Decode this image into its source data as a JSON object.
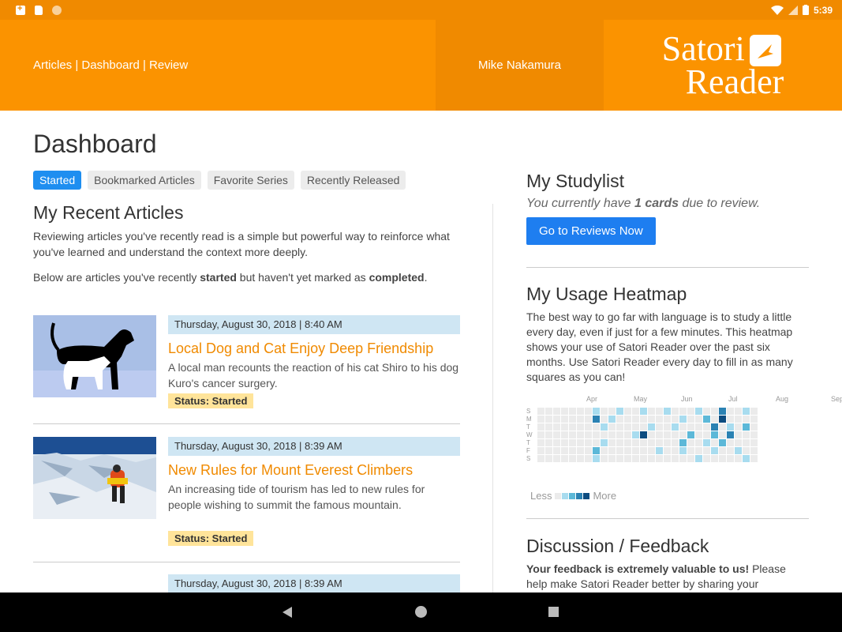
{
  "status_bar": {
    "time": "5:39"
  },
  "header": {
    "nav_links": "Articles | Dashboard | Review",
    "user_name": "Mike Nakamura",
    "logo_line1": "Satori",
    "logo_line2": "Reader"
  },
  "page_title": "Dashboard",
  "tabs": [
    {
      "label": "Started"
    },
    {
      "label": "Bookmarked Articles"
    },
    {
      "label": "Favorite Series"
    },
    {
      "label": "Recently Released"
    }
  ],
  "recent": {
    "title": "My Recent Articles",
    "intro": "Reviewing articles you've recently read is a simple but powerful way to reinforce what you've learned and understand the context more deeply.",
    "note_pre": "Below are articles you've recently ",
    "note_bold1": "started",
    "note_mid": " but haven't yet marked as ",
    "note_bold2": "completed",
    "note_end": "."
  },
  "articles": [
    {
      "date": "Thursday, August 30, 2018 | 8:40 AM",
      "title": "Local Dog and Cat Enjoy Deep Friendship",
      "summary": "A local man recounts the reaction of his cat Shiro to his dog Kuro's cancer surgery.",
      "status": "Status: Started"
    },
    {
      "date": "Thursday, August 30, 2018 | 8:39 AM",
      "title": "New Rules for Mount Everest Climbers",
      "summary": "An increasing tide of tourism has led to new rules for people wishing to summit the famous mountain.",
      "status": "Status: Started"
    },
    {
      "date": "Thursday, August 30, 2018 | 8:39 AM"
    }
  ],
  "studylist": {
    "title": "My Studylist",
    "sub_pre": "You currently have ",
    "sub_count": "1 cards",
    "sub_post": " due to review.",
    "button": "Go to Reviews Now"
  },
  "heatmap": {
    "title": "My Usage Heatmap",
    "description": "The best way to go far with language is to study a little every day, even if just for a few minutes. This heatmap shows your use of Satori Reader over the past six months. Use Satori Reader every day to fill in as many squares as you can!",
    "months": [
      "Apr",
      "May",
      "Jun",
      "Jul",
      "Aug",
      "Sep"
    ],
    "days": [
      "S",
      "M",
      "T",
      "W",
      "T",
      "F",
      "S"
    ],
    "legend_less": "Less",
    "legend_more": "More",
    "colors": [
      "#ebebeb",
      "#a8dcef",
      "#5cb8d8",
      "#2b82b3",
      "#0d4c80"
    ],
    "active": [
      [
        19,
        0,
        1
      ],
      [
        19,
        1,
        3
      ],
      [
        19,
        5,
        2
      ],
      [
        19,
        6,
        1
      ],
      [
        20,
        2,
        1
      ],
      [
        20,
        4,
        1
      ],
      [
        21,
        1,
        1
      ],
      [
        22,
        0,
        1
      ],
      [
        24,
        3,
        1
      ],
      [
        25,
        3,
        4
      ],
      [
        25,
        0,
        1
      ],
      [
        26,
        2,
        1
      ],
      [
        27,
        5,
        1
      ],
      [
        28,
        0,
        1
      ],
      [
        29,
        2,
        1
      ],
      [
        30,
        1,
        1
      ],
      [
        30,
        4,
        2
      ],
      [
        30,
        5,
        1
      ],
      [
        31,
        3,
        2
      ],
      [
        32,
        0,
        1
      ],
      [
        32,
        6,
        1
      ],
      [
        33,
        1,
        2
      ],
      [
        33,
        4,
        1
      ],
      [
        34,
        2,
        3
      ],
      [
        34,
        3,
        2
      ],
      [
        34,
        5,
        1
      ],
      [
        35,
        0,
        3
      ],
      [
        35,
        1,
        4
      ],
      [
        35,
        4,
        2
      ],
      [
        36,
        2,
        1
      ],
      [
        36,
        3,
        3
      ],
      [
        37,
        5,
        1
      ],
      [
        38,
        0,
        1
      ],
      [
        38,
        2,
        2
      ],
      [
        38,
        6,
        1
      ]
    ]
  },
  "feedback": {
    "title": "Discussion / Feedback",
    "bold": "Your feedback is extremely valuable to us!",
    "text": " Please help make Satori Reader better by sharing your"
  }
}
